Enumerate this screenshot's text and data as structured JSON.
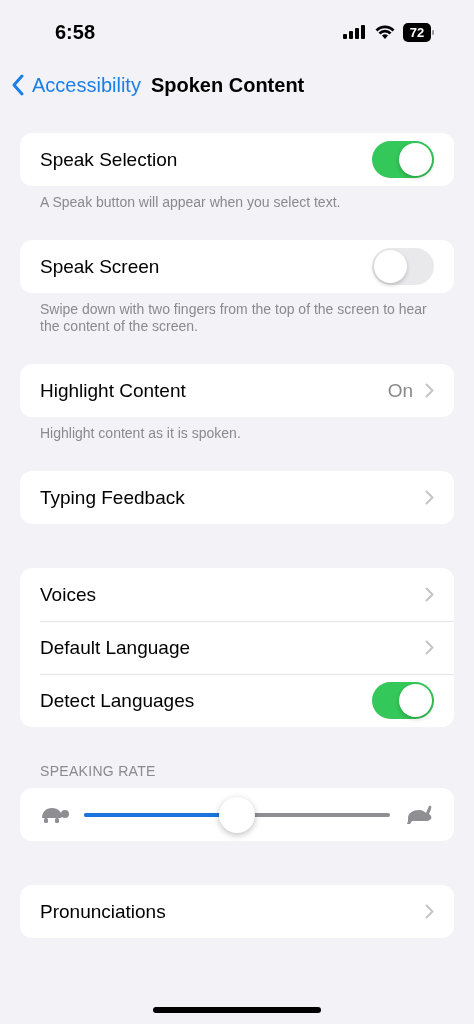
{
  "status_bar": {
    "time": "6:58",
    "battery": "72"
  },
  "nav": {
    "back": "Accessibility",
    "title": "Spoken Content"
  },
  "groups": [
    {
      "rows": [
        {
          "kind": "toggle",
          "label": "Speak Selection",
          "on": true
        }
      ],
      "footer": "A Speak button will appear when you select text."
    },
    {
      "rows": [
        {
          "kind": "toggle",
          "label": "Speak Screen",
          "on": false
        }
      ],
      "footer": "Swipe down with two fingers from the top of the screen to hear the content of the screen."
    },
    {
      "rows": [
        {
          "kind": "value",
          "label": "Highlight Content",
          "value": "On"
        }
      ],
      "footer": "Highlight content as it is spoken."
    },
    {
      "rows": [
        {
          "kind": "link",
          "label": "Typing Feedback"
        }
      ]
    },
    {
      "rows": [
        {
          "kind": "link",
          "label": "Voices"
        },
        {
          "kind": "link",
          "label": "Default Language"
        },
        {
          "kind": "toggle",
          "label": "Detect Languages",
          "on": true
        }
      ]
    },
    {
      "header": "SPEAKING RATE",
      "rows": [
        {
          "kind": "slider",
          "level": 0.5
        }
      ]
    },
    {
      "rows": [
        {
          "kind": "link",
          "label": "Pronunciations"
        }
      ]
    }
  ]
}
